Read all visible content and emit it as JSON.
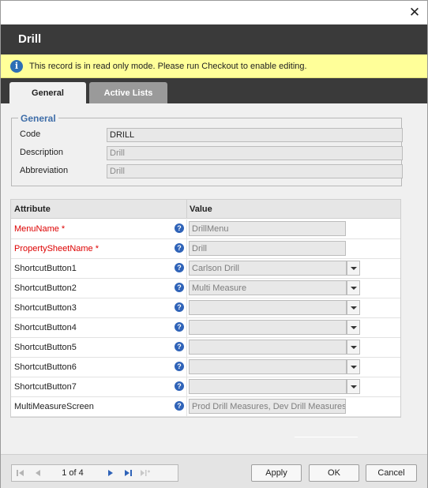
{
  "window": {
    "close_icon": "close-icon",
    "title": "Drill"
  },
  "notice": {
    "icon": "info-icon",
    "text": "This record is in read only mode. Please run Checkout to enable editing."
  },
  "tabs": [
    {
      "label": "General",
      "active": true
    },
    {
      "label": "Active Lists",
      "active": false
    }
  ],
  "general": {
    "legend": "General",
    "fields": [
      {
        "label": "Code",
        "value": "DRILL"
      },
      {
        "label": "Description",
        "value": "Drill"
      },
      {
        "label": "Abbreviation",
        "value": "Drill"
      }
    ]
  },
  "grid": {
    "headers": {
      "attribute": "Attribute",
      "value": "Value"
    },
    "help_icon": "help-icon",
    "rows": [
      {
        "attribute": "MenuName *",
        "required": true,
        "value": "DrillMenu",
        "type": "text"
      },
      {
        "attribute": "PropertySheetName *",
        "required": true,
        "value": "Drill",
        "type": "text"
      },
      {
        "attribute": "ShortcutButton1",
        "required": false,
        "value": "Carlson Drill",
        "type": "select"
      },
      {
        "attribute": "ShortcutButton2",
        "required": false,
        "value": "Multi Measure",
        "type": "select"
      },
      {
        "attribute": "ShortcutButton3",
        "required": false,
        "value": "",
        "type": "select"
      },
      {
        "attribute": "ShortcutButton4",
        "required": false,
        "value": "",
        "type": "select"
      },
      {
        "attribute": "ShortcutButton5",
        "required": false,
        "value": "",
        "type": "select"
      },
      {
        "attribute": "ShortcutButton6",
        "required": false,
        "value": "",
        "type": "select"
      },
      {
        "attribute": "ShortcutButton7",
        "required": false,
        "value": "",
        "type": "select"
      },
      {
        "attribute": "MultiMeasureScreen",
        "required": false,
        "value": "Prod Drill Measures, Dev Drill Measures",
        "type": "text"
      }
    ]
  },
  "pager": {
    "info": "1 of 4",
    "icons": [
      "first-page-icon",
      "prev-page-icon",
      "next-page-icon",
      "last-page-icon",
      "new-record-icon"
    ]
  },
  "buttons": {
    "apply": "Apply",
    "ok": "OK",
    "cancel": "Cancel"
  },
  "colors": {
    "header_bg": "#3a3a3a",
    "notice_bg": "#ffff99",
    "required_text": "#dd0000",
    "legend_text": "#3e6da8",
    "help_icon": "#2f63b8"
  }
}
